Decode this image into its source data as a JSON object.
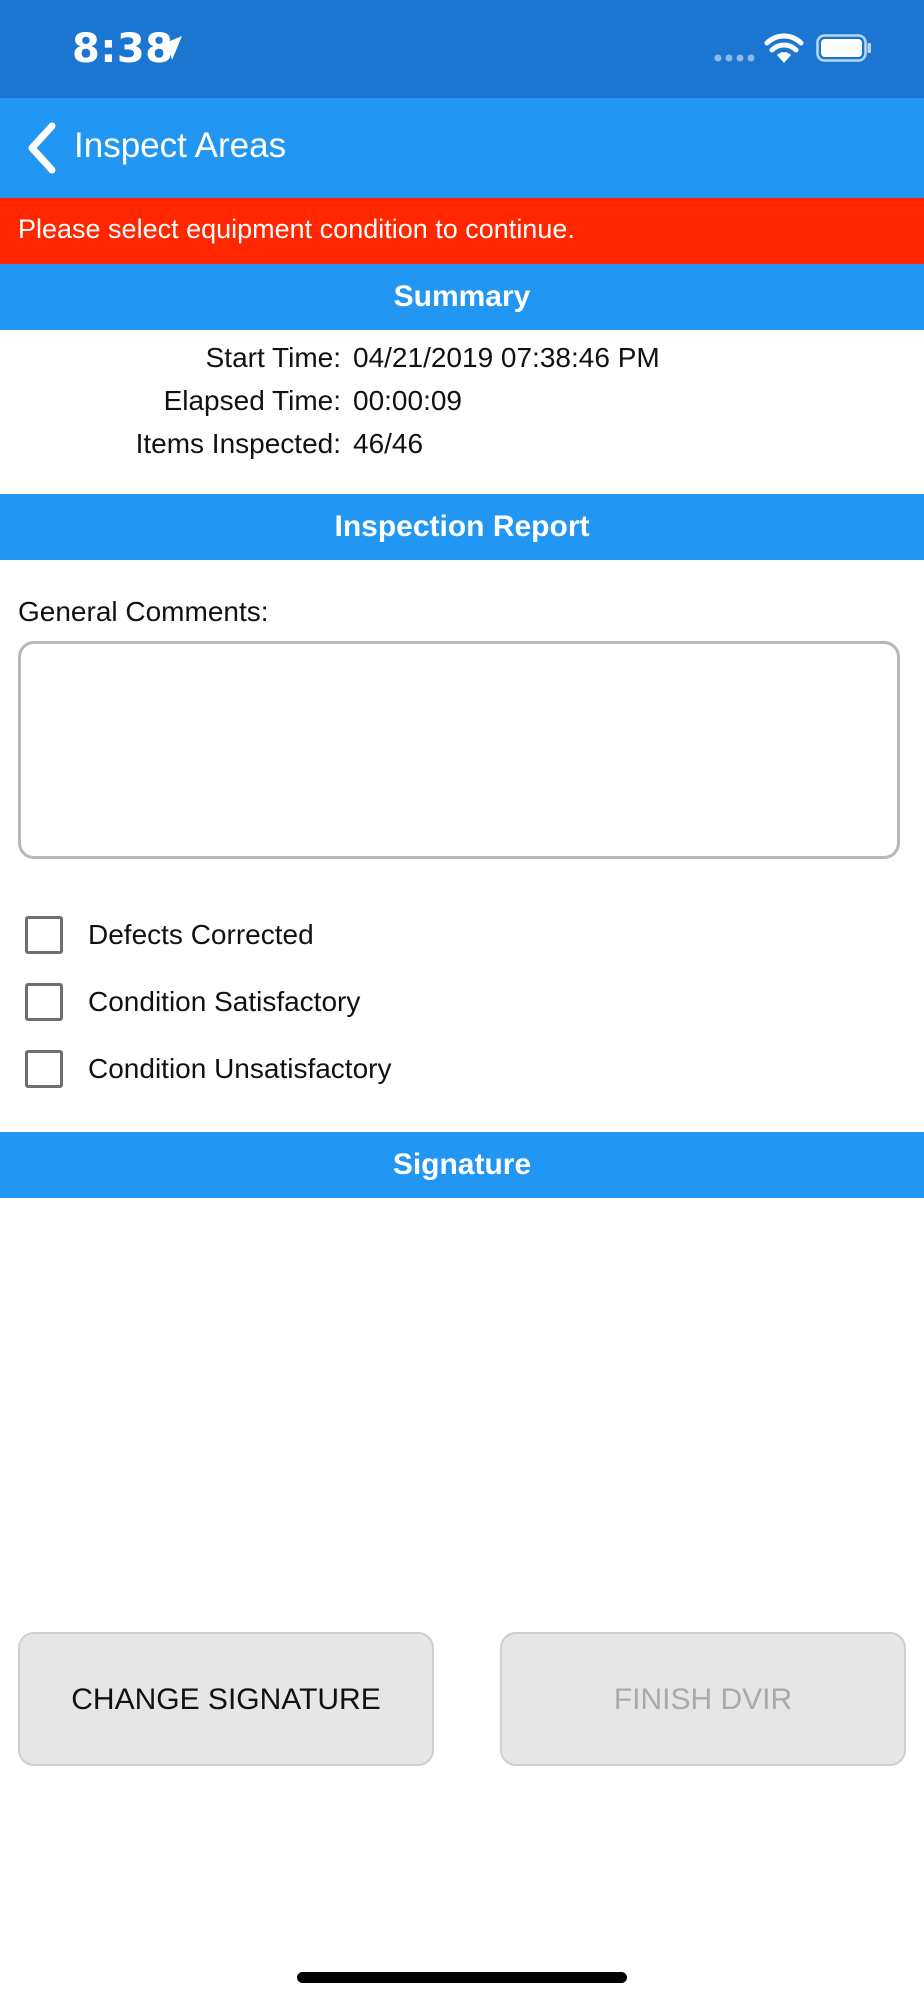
{
  "status_bar": {
    "time": "8:38"
  },
  "nav": {
    "back_title": "Inspect Areas"
  },
  "error_banner": {
    "message": "Please select equipment condition to continue."
  },
  "summary": {
    "header": "Summary",
    "rows": [
      {
        "label": "Start Time:",
        "value": "04/21/2019 07:38:46 PM"
      },
      {
        "label": "Elapsed Time:",
        "value": "00:00:09"
      },
      {
        "label": "Items Inspected:",
        "value": "46/46"
      }
    ]
  },
  "report": {
    "header": "Inspection Report",
    "comments_label": "General Comments:",
    "comments_value": "",
    "options": [
      {
        "label": "Defects Corrected",
        "checked": false
      },
      {
        "label": "Condition Satisfactory",
        "checked": false
      },
      {
        "label": "Condition Unsatisfactory",
        "checked": false
      }
    ]
  },
  "signature": {
    "header": "Signature"
  },
  "buttons": {
    "change_signature": "CHANGE SIGNATURE",
    "finish_dvir": "FINISH DVIR"
  },
  "colors": {
    "status_bar": "#1b76d1",
    "nav_bar": "#2196f3",
    "error": "#ff2600",
    "button_bg": "#e6e6e6",
    "disabled_text": "#aaaaaa"
  },
  "icons": {
    "back": "chevron-left-icon",
    "location": "location-arrow-icon",
    "wifi": "wifi-icon",
    "battery": "battery-icon",
    "signal": "signal-dots-icon"
  }
}
